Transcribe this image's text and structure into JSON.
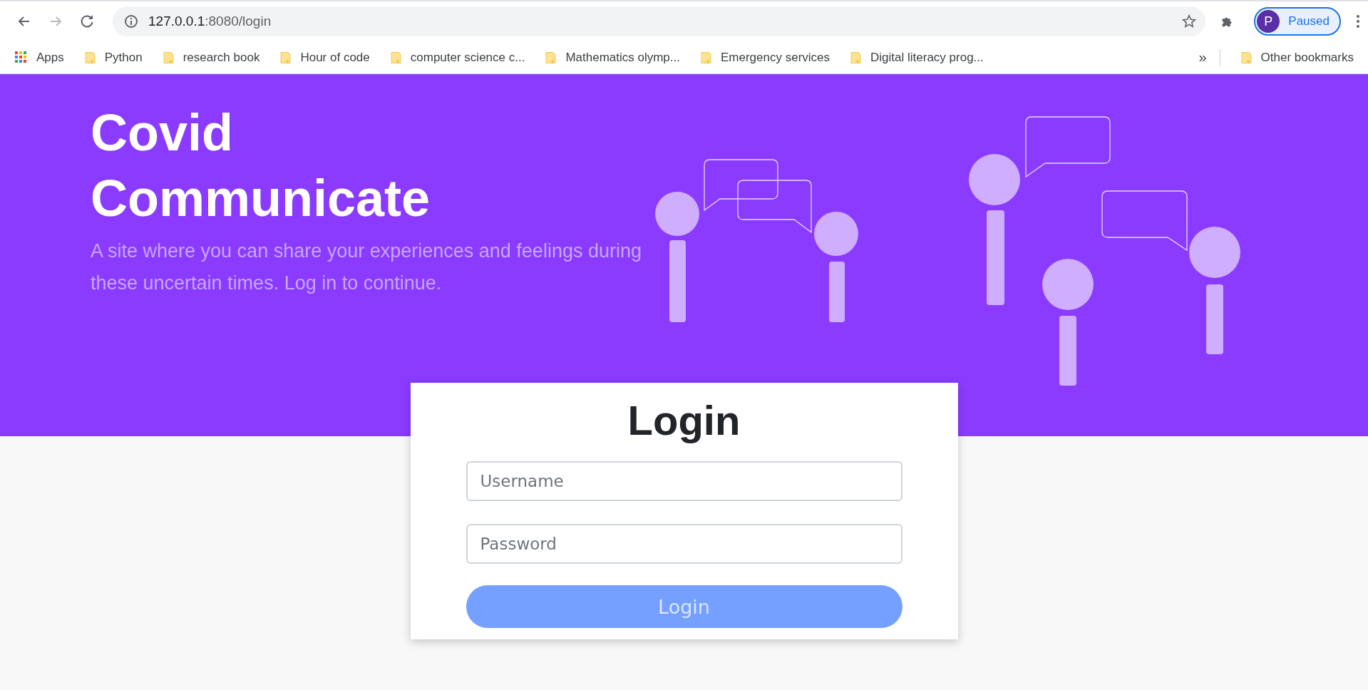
{
  "browser": {
    "nav_buttons": [
      {
        "kind": "back",
        "disabled": false
      },
      {
        "kind": "forward",
        "disabled": true
      },
      {
        "kind": "reload",
        "disabled": false
      }
    ],
    "address": {
      "host": "127.0.0.1",
      "path": ":8080/login"
    },
    "profile": {
      "initial": "P",
      "status": "Paused"
    },
    "bookmarks": [
      {
        "kind": "apps",
        "label": "Apps"
      },
      {
        "kind": "folder",
        "label": "Python"
      },
      {
        "kind": "folder",
        "label": "research book"
      },
      {
        "kind": "folder",
        "label": "Hour of code"
      },
      {
        "kind": "folder",
        "label": "computer science c..."
      },
      {
        "kind": "folder",
        "label": "Mathematics olymp..."
      },
      {
        "kind": "folder",
        "label": "Emergency services"
      },
      {
        "kind": "folder",
        "label": "Digital literacy prog..."
      }
    ],
    "overflow": "»",
    "other_bookmarks": "Other bookmarks"
  },
  "hero": {
    "title": "Covid Communicate",
    "subtitle": "A site where you can share your experiences and feelings during these uncertain times. Log in to continue."
  },
  "login": {
    "title": "Login",
    "fields": [
      {
        "placeholder": "Username"
      },
      {
        "placeholder": "Password"
      }
    ],
    "button": "Login"
  }
}
